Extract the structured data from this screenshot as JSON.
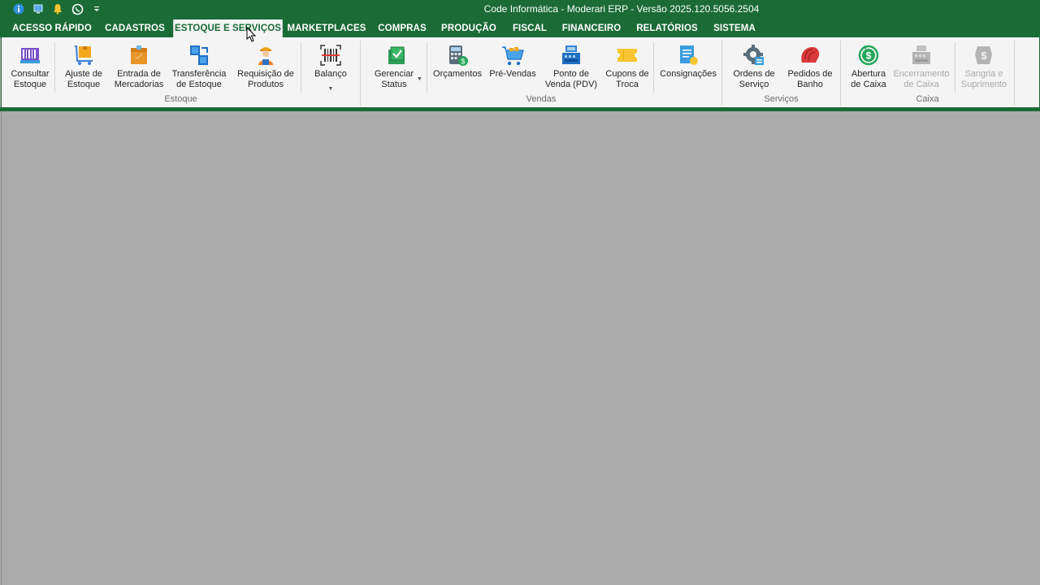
{
  "window": {
    "title": "Code Informática - Moderari ERP - Versão 2025.120.5056.2504"
  },
  "quick_access": [
    {
      "icon": "info-icon"
    },
    {
      "icon": "monitor-icon"
    },
    {
      "icon": "bell-icon"
    },
    {
      "icon": "whatsapp-icon"
    },
    {
      "icon": "customize-dropdown-icon"
    }
  ],
  "tabs": [
    {
      "label": "ACESSO RÁPIDO",
      "active": false
    },
    {
      "label": "CADASTROS",
      "active": false
    },
    {
      "label": "ESTOQUE E SERVIÇOS",
      "active": true
    },
    {
      "label": "MARKETPLACES",
      "active": false
    },
    {
      "label": "COMPRAS",
      "active": false
    },
    {
      "label": "PRODUÇÃO",
      "active": false
    },
    {
      "label": "FISCAL",
      "active": false
    },
    {
      "label": "FINANCEIRO",
      "active": false
    },
    {
      "label": "RELATÓRIOS",
      "active": false
    },
    {
      "label": "SISTEMA",
      "active": false
    }
  ],
  "ribbon": {
    "buttons": [
      {
        "label": "Consultar\nEstoque",
        "icon": "barcode-scan-icon",
        "enabled": true
      },
      {
        "label": "Ajuste de\nEstoque",
        "icon": "box-cart-icon",
        "enabled": true
      },
      {
        "label": "Entrada de\nMercadorias",
        "icon": "package-box-icon",
        "enabled": true
      },
      {
        "label": "Transferência\nde Estoque",
        "icon": "transfer-icon",
        "enabled": true
      },
      {
        "label": "Requisição de\nProdutos",
        "icon": "worker-icon",
        "enabled": true
      },
      {
        "label": "Balanço",
        "icon": "barcode-icon",
        "enabled": true,
        "dropdown": true
      },
      {
        "label": "Gerenciar\nStatus",
        "icon": "checkbox-icon",
        "enabled": true,
        "dropdown": true
      },
      {
        "label": "Orçamentos",
        "icon": "calculator-icon",
        "enabled": true
      },
      {
        "label": "Pré-Vendas",
        "icon": "shopping-cart-icon",
        "enabled": true
      },
      {
        "label": "Ponto de\nVenda (PDV)",
        "icon": "pos-register-icon",
        "enabled": true
      },
      {
        "label": "Cupons de\nTroca",
        "icon": "coupon-icon",
        "enabled": true
      },
      {
        "label": "Consignações",
        "icon": "document-icon",
        "enabled": true
      },
      {
        "label": "Ordens de\nServiço",
        "icon": "gear-icon",
        "enabled": true
      },
      {
        "label": "Pedidos de\nBanho",
        "icon": "bath-icon",
        "enabled": true
      },
      {
        "label": "Abertura\nde Caixa",
        "icon": "cash-open-icon",
        "enabled": true
      },
      {
        "label": "Encerramento\nde Caixa",
        "icon": "cash-register-icon",
        "enabled": false
      },
      {
        "label": "Sangria e\nSuprimento",
        "icon": "cash-withdraw-icon",
        "enabled": false
      }
    ],
    "groups": [
      {
        "label": "Estoque"
      },
      {
        "label": "Vendas"
      },
      {
        "label": "Serviços"
      },
      {
        "label": "Caixa"
      }
    ]
  },
  "colors": {
    "brand_green": "#1a6b35",
    "ribbon_bg": "#f4f4f4",
    "workspace_bg": "#ababab"
  }
}
